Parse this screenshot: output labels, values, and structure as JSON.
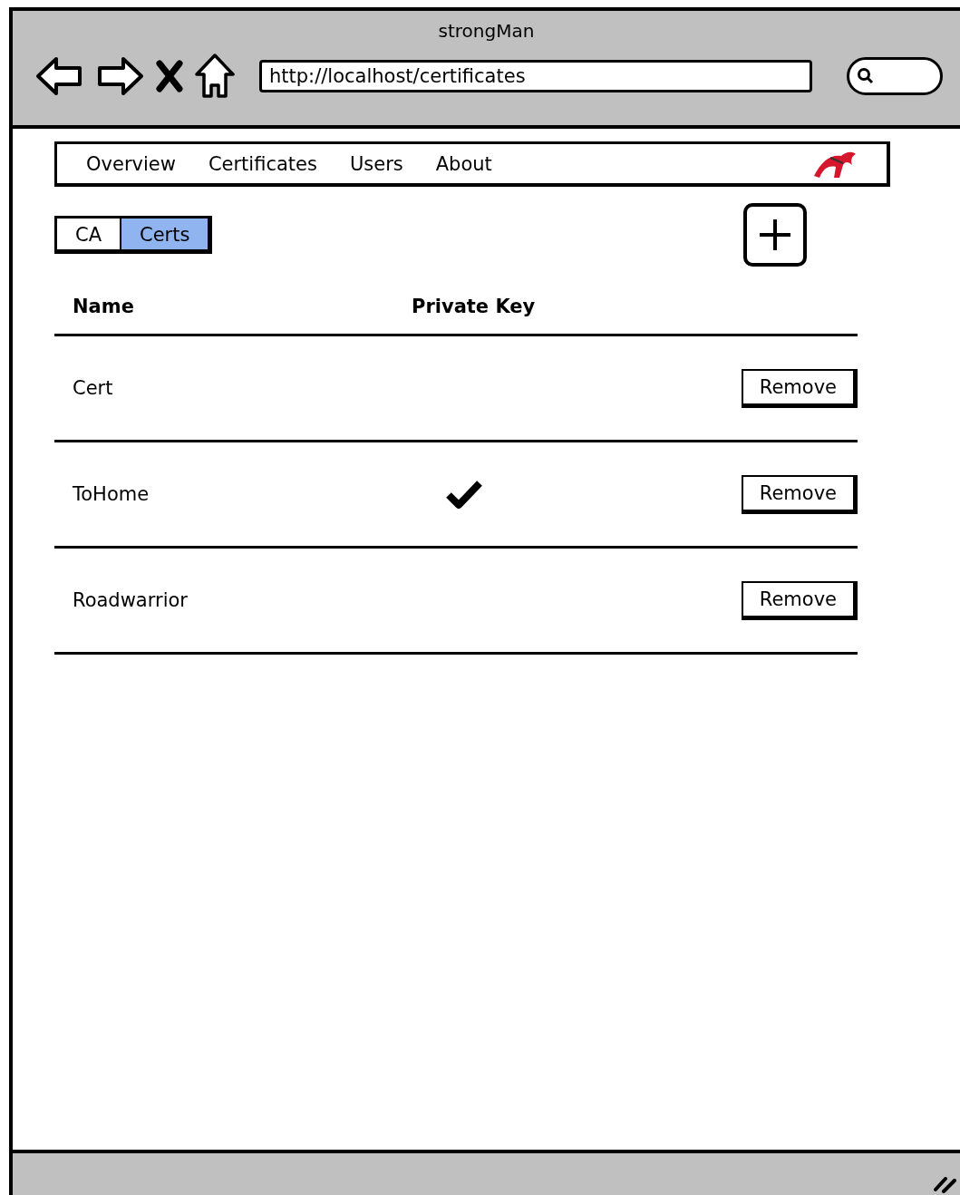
{
  "window": {
    "title": "strongMan",
    "url": "http://localhost/certificates"
  },
  "nav": [
    "Overview",
    "Certificates",
    "Users",
    "About"
  ],
  "tabs": [
    {
      "label": "CA",
      "selected": false
    },
    {
      "label": "Certs",
      "selected": true
    }
  ],
  "table": {
    "columns": [
      "Name",
      "Private Key"
    ],
    "rows": [
      {
        "name": "Cert",
        "private_key": false,
        "action": "Remove"
      },
      {
        "name": "ToHome",
        "private_key": true,
        "action": "Remove"
      },
      {
        "name": "Roadwarrior",
        "private_key": false,
        "action": "Remove"
      }
    ]
  }
}
